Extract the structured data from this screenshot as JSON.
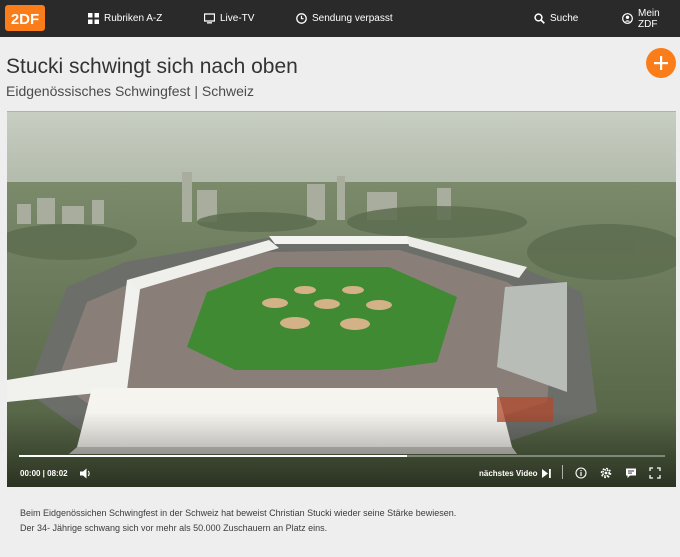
{
  "brand": {
    "name": "ZDF",
    "accent_color": "#fa7d19",
    "logo_text": "2DF"
  },
  "nav": {
    "rubriken": {
      "label": "Rubriken A-Z",
      "icon": "grid-icon"
    },
    "livetv": {
      "label": "Live-TV",
      "icon": "tv-icon"
    },
    "verpasst": {
      "label": "Sendung verpasst",
      "icon": "clock-icon"
    },
    "suche": {
      "label": "Suche",
      "icon": "search-icon"
    },
    "meinzdf": {
      "label": "Mein ZDF",
      "icon": "user-icon"
    }
  },
  "header": {
    "title": "Stucki schwingt sich nach oben",
    "subtitle": "Eidgenössisches Schwingfest | Schweiz"
  },
  "player": {
    "time_display": "00:00 | 08:02",
    "progress": 0.6,
    "next_label": "nächstes Video",
    "icons": [
      "volume-icon",
      "skip-next-icon",
      "info-icon",
      "settings-icon",
      "subtitles-icon",
      "fullscreen-icon"
    ]
  },
  "description": "Beim Eidgenössichen Schwingfest in der Schweiz hat beweist Christian Stucki wieder seine Stärke bewiesen. Der 34- Jährige schwang sich vor mehr als 50.000 Zuschauern an Platz eins."
}
